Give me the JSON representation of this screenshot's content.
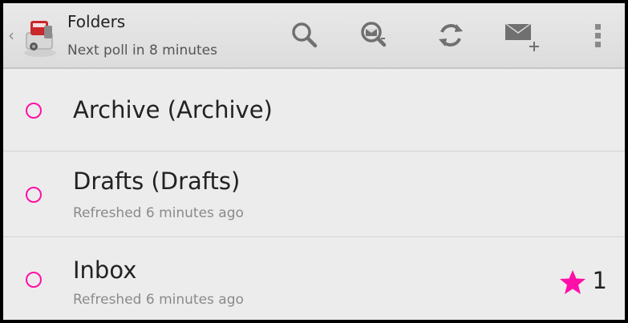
{
  "action_bar": {
    "title": "Folders",
    "subtitle": "Next poll in 8 minutes",
    "actions": [
      "search-icon",
      "search-remote-icon",
      "refresh-icon",
      "compose-icon",
      "overflow-menu-icon"
    ]
  },
  "folders": [
    {
      "name": "Archive (Archive)",
      "status": ""
    },
    {
      "name": "Drafts (Drafts)",
      "status": "Refreshed 6 minutes ago"
    },
    {
      "name": "Inbox",
      "status": "Refreshed 6 minutes ago",
      "flagged_count": "1"
    }
  ],
  "colors": {
    "accent": "#ff0fa8",
    "background": "#ececec",
    "text_primary": "#222222",
    "text_secondary": "#8a8a8a"
  }
}
